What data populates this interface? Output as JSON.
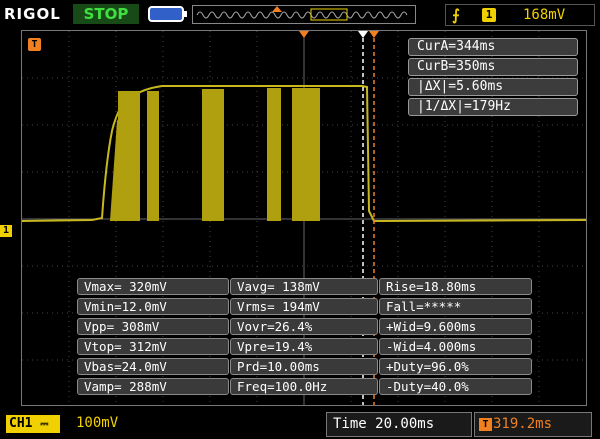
{
  "header": {
    "brand": "RIGOL",
    "run_state": "STOP",
    "trigger_edge_icon": "rising-edge-icon",
    "trigger_source": "1",
    "trigger_level": "168mV"
  },
  "markers": {
    "channel_marker": "1",
    "trigger_marker": "T"
  },
  "cursors": {
    "cur_a": "CurA=344ms",
    "cur_b": "CurB=350ms",
    "delta_x": "|ΔX|=5.60ms",
    "inv_delta_x": "|1/ΔX|=179Hz"
  },
  "measurements": {
    "col1": [
      "Vmax= 320mV",
      "Vmin=12.0mV",
      "Vpp= 308mV",
      "Vtop= 312mV",
      "Vbas=24.0mV",
      "Vamp= 288mV"
    ],
    "col2": [
      "Vavg= 138mV",
      "Vrms= 194mV",
      "Vovr=26.4%",
      "Vpre=19.4%",
      "Prd=10.00ms",
      "Freq=100.0Hz"
    ],
    "col3": [
      "Rise=18.80ms",
      "Fall=*****",
      "+Wid=9.600ms",
      "-Wid=4.000ms",
      "+Duty=96.0%",
      "-Duty=40.0%"
    ]
  },
  "footer": {
    "channel_label": "CH1",
    "channel_scale": "100mV",
    "timebase": "Time 20.00ms",
    "trigger_offset": "319.2ms"
  },
  "colors": {
    "trace": "#c8b820",
    "run_state": "#40e040",
    "channel": "#f0d000",
    "trigger": "#f08020",
    "battery": "#3060c8"
  }
}
